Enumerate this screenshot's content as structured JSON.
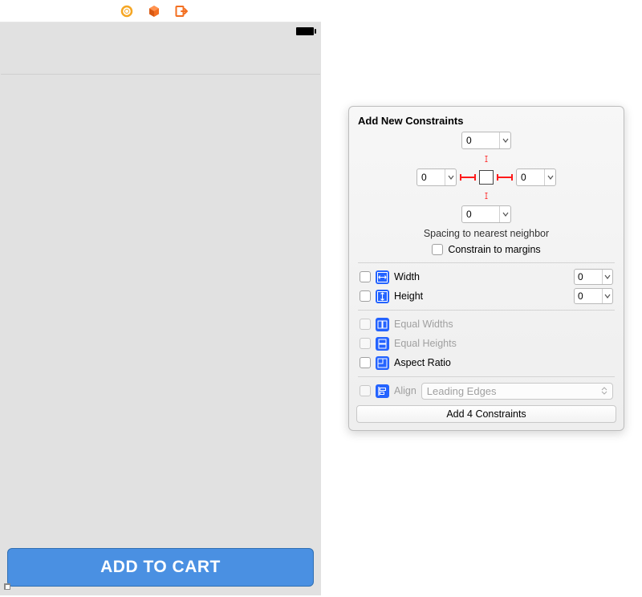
{
  "device": {
    "button_label": "ADD TO CART"
  },
  "popover": {
    "title": "Add New Constraints",
    "spacing": {
      "top": "0",
      "left": "0",
      "right": "0",
      "bottom": "0",
      "caption": "Spacing to nearest neighbor"
    },
    "constrain_to_margins": "Constrain to margins",
    "width": {
      "label": "Width",
      "value": "0"
    },
    "height": {
      "label": "Height",
      "value": "0"
    },
    "equal_widths": "Equal Widths",
    "equal_heights": "Equal Heights",
    "aspect_ratio": "Aspect Ratio",
    "align": {
      "label": "Align",
      "value": "Leading Edges"
    },
    "submit": "Add 4 Constraints"
  }
}
